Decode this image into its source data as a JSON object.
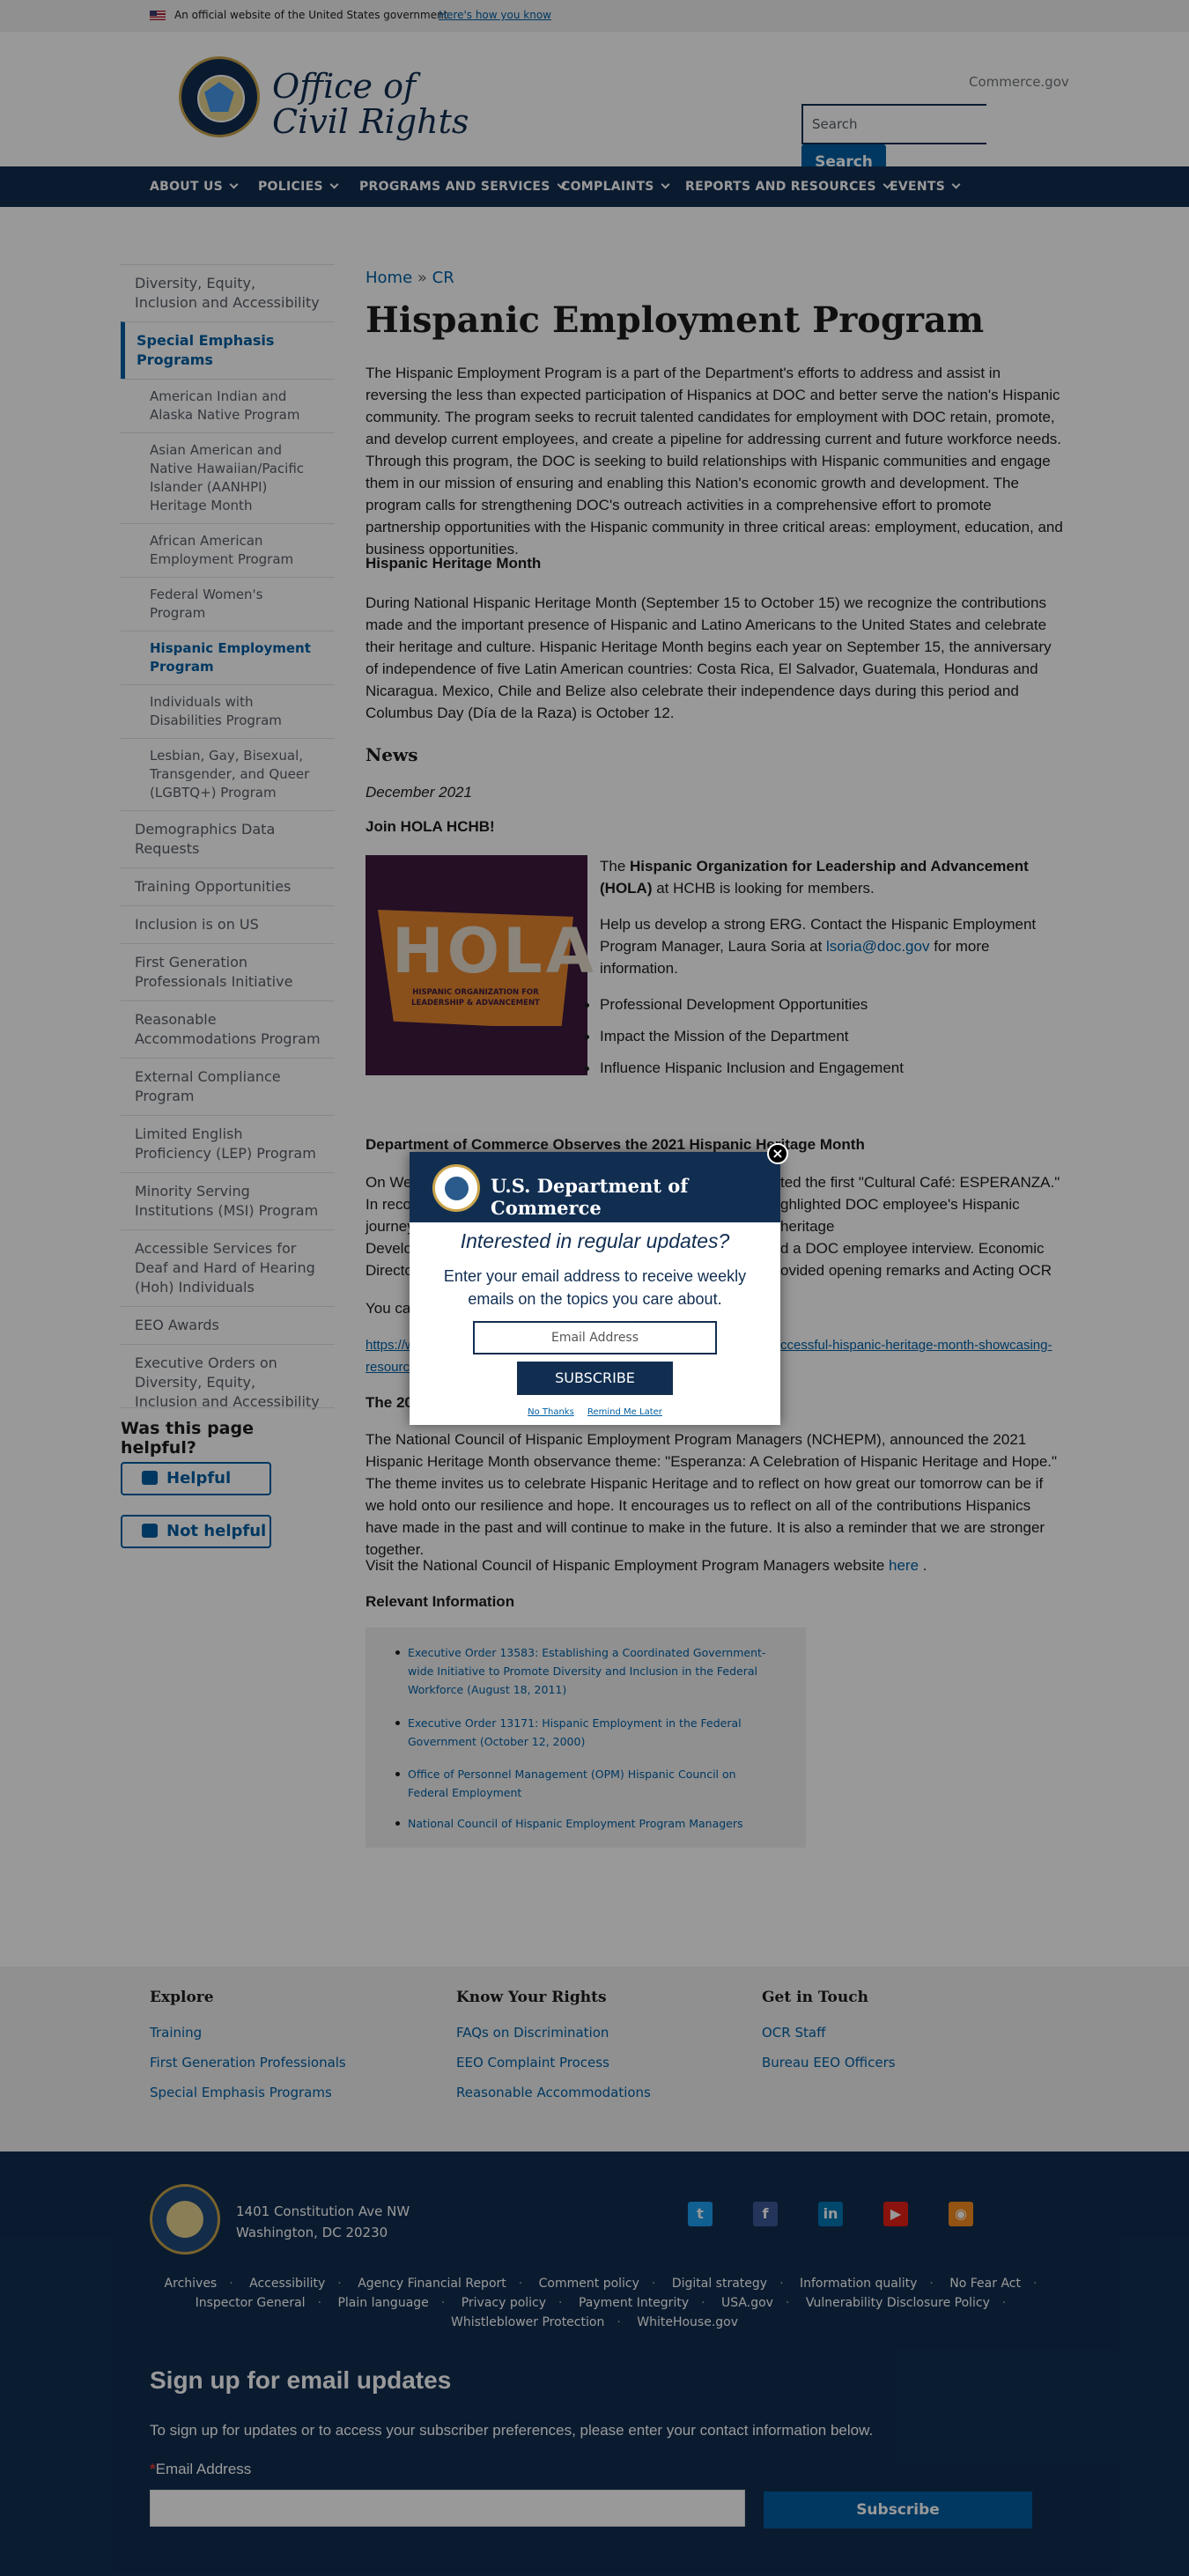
{
  "banner": {
    "text": "An official website of the United States government",
    "how": "Here's how you know"
  },
  "header": {
    "logo_line1": "Office of",
    "logo_line2": "Civil Rights",
    "commerce_link": "Commerce.gov",
    "search_placeholder": "Search",
    "search_button": "Search"
  },
  "nav": {
    "items": [
      "ABOUT US",
      "POLICIES",
      "PROGRAMS AND SERVICES",
      "COMPLAINTS",
      "REPORTS AND RESOURCES",
      "EVENTS"
    ]
  },
  "sidenav": {
    "items": [
      "Diversity, Equity, Inclusion and Accessibility",
      "Special Emphasis Programs",
      "American Indian and Alaska Native Program",
      "Asian American and Native Hawaiian/Pacific Islander (AANHPI) Heritage Month",
      "African American Employment Program",
      "Federal Women's Program",
      "Hispanic Employment Program",
      "Individuals with Disabilities Program",
      "Lesbian, Gay, Bisexual, Transgender, and Queer (LGBTQ+) Program",
      "Demographics Data Requests",
      "Training Opportunities",
      "Inclusion is on US",
      "First Generation Professionals Initiative",
      "Reasonable Accommodations Program",
      "External Compliance Program",
      "Limited English Proficiency (LEP) Program",
      "Minority Serving Institutions (MSI) Program",
      "Accessible Services for Deaf and Hard of Hearing (Hoh) Individuals",
      "EEO Awards",
      "Executive Orders on Diversity, Equity, Inclusion and Accessibility"
    ]
  },
  "helpful": {
    "title": "Was this page helpful?",
    "yes": "Helpful",
    "no": "Not helpful"
  },
  "breadcrumb": {
    "home": "Home",
    "sep": "»",
    "current": "CR"
  },
  "page": {
    "title": "Hispanic Employment Program",
    "intro": "The Hispanic Employment Program is a part of the Department's efforts to address and assist in reversing the less than expected participation of Hispanics at DOC and better serve the nation's Hispanic community. The program seeks to recruit talented candidates for employment with DOC retain, promote, and develop current employees, and create a pipeline for addressing current and future workforce needs. Through this program, the DOC is seeking to build relationships with Hispanic communities and engage them in our mission of ensuring and enabling this Nation's economic growth and development. The program calls for strengthening DOC's outreach activities in a comprehensive effort to promote partnership opportunities with the Hispanic community in three critical areas: employment, education, and business opportunities.",
    "heritage_heading": "Hispanic Heritage Month",
    "heritage_text": "During National Hispanic Heritage Month (September 15 to October 15) we recognize the contributions made and the important presence of Hispanic and Latino Americans to the United States and celebrate their heritage and culture. Hispanic Heritage Month begins each year on September 15, the anniversary of independence of five Latin American countries: Costa Rica, El Salvador, Guatemala, Honduras and Nicaragua. Mexico, Chile and Belize also celebrate their independence days during this period and Columbus Day (Día de la Raza) is October 12.",
    "news_heading": "News",
    "news_date": "December 2021",
    "join_heading": "Join HOLA HCHB!",
    "hola_img": {
      "big": "HOLA",
      "small": "HISPANIC ORGANIZATION FOR LEADERSHIP & ADVANCEMENT"
    },
    "hola_p1_pre": "The ",
    "hola_p1_bold": "Hispanic Organization for Leadership and Advancement (HOLA)",
    "hola_p1_post": " at HCHB is looking for members.",
    "hola_p2_pre": "Help us develop a strong ERG. Contact the Hispanic Employment Program Manager, Laura Soria at ",
    "hola_p2_link": "lsoria@doc.gov",
    "hola_p2_post": " for more information.",
    "bullets": [
      "Professional Development Opportunities",
      "Impact the Mission of the Department",
      "Influence Hispanic Inclusion and Engagement"
    ],
    "observes_heading": "Department of Commerce Observes the 2021 Hispanic Heritage Month",
    "observes_l1a": "On We",
    "observes_l1b": "ted the first \"Cultural Café: ESPERANZA.\"",
    "observes_l2a": "In reco",
    "observes_l2b": "ghlighted DOC employee's Hispanic heritage",
    "observes_l3a": "journey",
    "observes_l3b": "d a DOC employee interview. Economic",
    "observes_l4a": "Develo",
    "observes_l4b": "ovided opening remarks and Acting OCR",
    "observes_l5a": "Directo",
    "you_can": "You ca",
    "link_a": "https://w",
    "link_b": "ccessful-hispanic-heritage-month-showcasing-",
    "link_c": "resourc",
    "the20": "The 20",
    "nchepm_text": "The National Council of Hispanic Employment Program Managers (NCHEPM), announced the 2021 Hispanic Heritage Month observance theme: \"Esperanza: A Celebration of Hispanic Heritage and Hope.\" The theme invites us to celebrate Hispanic Heritage and to reflect on how great our tomorrow can be if we hold onto our resilience and hope. It encourages us to reflect on all of the contributions Hispanics have made in the past and will continue to make in the future. It is also a reminder that we are stronger together.",
    "visit_pre": "Visit the National Council of Hispanic Employment Program Managers website ",
    "visit_link": "here",
    "visit_post": " .",
    "relevant_heading": "Relevant Information",
    "relevant": [
      "Executive Order 13583: Establishing a Coordinated Government-wide Initiative to Promote Diversity and Inclusion in the Federal Workforce (August 18, 2011)",
      "Executive Order 13171: Hispanic Employment in the Federal Government (October 12, 2000)",
      "Office of Personnel Management (OPM) Hispanic Council on Federal Employment",
      "National Council of Hispanic Employment Program Managers"
    ]
  },
  "footer": {
    "cols": [
      {
        "title": "Explore",
        "links": [
          "Training",
          "First Generation Professionals",
          "Special Emphasis Programs"
        ]
      },
      {
        "title": "Know Your Rights",
        "links": [
          "FAQs on Discrimination",
          "EEO Complaint Process",
          "Reasonable Accommodations"
        ]
      },
      {
        "title": "Get in Touch",
        "links": [
          "OCR Staff",
          "Bureau EEO Officers"
        ]
      }
    ],
    "addr1": "1401 Constitution Ave NW",
    "addr2": "Washington, DC 20230",
    "social": [
      "twitter-icon",
      "facebook-icon",
      "linkedin-icon",
      "youtube-icon",
      "rss-icon"
    ],
    "links_row1": [
      "Archives",
      "Accessibility",
      "Agency Financial Report",
      "Comment policy",
      "Digital strategy",
      "Information quality",
      "No Fear Act"
    ],
    "links_row2": [
      "Inspector General",
      "Plain language",
      "Privacy policy",
      "Payment Integrity",
      "USA.gov",
      "Vulnerability Disclosure Policy"
    ],
    "links_row3": [
      "Whistleblower Protection",
      "WhiteHouse.gov"
    ],
    "signup_title": "Sign up for email updates",
    "signup_desc": "To sign up for updates or to access your subscriber preferences, please enter your contact information below.",
    "signup_req": "*",
    "signup_label": "Email Address",
    "signup_button": "Subscribe"
  },
  "modal": {
    "title": "U.S. Department of Commerce",
    "question": "Interested in regular updates?",
    "desc": "Enter your email address to receive weekly emails on the topics you care about.",
    "placeholder": "Email Address",
    "button": "SUBSCRIBE",
    "no_thanks": "No Thanks",
    "remind": "Remind Me Later",
    "close": "×"
  }
}
